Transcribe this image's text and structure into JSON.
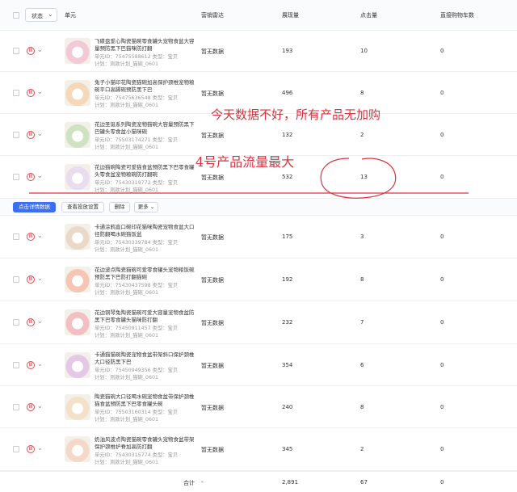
{
  "header": {
    "status_label": "状态",
    "unit": "单元",
    "radar": "营销雷达",
    "impressions": "展现量",
    "clicks": "点击量",
    "cart": "直接购物车数"
  },
  "rows_top": [
    {
      "name": "飞碟盘爱心陶瓷猫碗零食罐头宠物食盆大容量预防黑下巴猫咪防打翻",
      "unit_id": "单元ID：75475588612  类型：宝贝",
      "plan": "计划：测款计划_猫碗_0601",
      "radar": "暂无数据",
      "impressions": "193",
      "clicks": "10",
      "cart": "0",
      "thumb_color": "#f3c9d8"
    },
    {
      "name": "兔子小猫印花陶瓷猫碗加高保护颈椎宠物粮碗平口高脚碗预防黑下巴",
      "unit_id": "单元ID：75475636548  类型：宝贝",
      "plan": "计划：测款计划_猫碗_0601",
      "radar": "暂无数据",
      "impressions": "496",
      "clicks": "8",
      "cart": "0",
      "thumb_color": "#f4d8b8"
    },
    {
      "name": "花边圣诞系列陶瓷宠物猫碗大容量预防黑下巴罐头零食盆小猫咪碗",
      "unit_id": "单元ID：75503174271  类型：宝贝",
      "plan": "计划：测款计划_猫碗_0601",
      "radar": "暂无数据",
      "impressions": "132",
      "clicks": "2",
      "cart": "0",
      "thumb_color": "#cfe3c2"
    },
    {
      "name": "花边猫碗陶瓷可爱猫食盆预防黑下巴零食罐头零食盆宠物粮碗防打翻碗",
      "unit_id": "单元ID：75430319772  类型：宝贝",
      "plan": "计划：测款计划_猫碗_0601",
      "radar": "暂无数据",
      "impressions": "532",
      "clicks": "13",
      "cart": "0",
      "thumb_color": "#e8dcef"
    }
  ],
  "actions": {
    "detail": "点击详情数据",
    "view": "查看投放设置",
    "delete": "删除",
    "more": "更多"
  },
  "rows_bottom": [
    {
      "name": "卡通涂鸦直口碗印花猫咪陶瓷宠物食盆大口径防翻喝水碗猫饭盆",
      "unit_id": "单元ID：75430339784  类型：宝贝",
      "plan": "计划：测款计划_猫碗_0601",
      "radar": "暂无数据",
      "impressions": "175",
      "clicks": "3",
      "cart": "0",
      "thumb_color": "#ead9c6"
    },
    {
      "name": "花边波点陶瓷猫碗可爱零食罐头宠物粮饭碗预防黑下巴防打翻猫碗",
      "unit_id": "单元ID：75430437598  类型：宝贝",
      "plan": "计划：测款计划_猫碗_0601",
      "radar": "暂无数据",
      "impressions": "192",
      "clicks": "8",
      "cart": "0",
      "thumb_color": "#f6c6b5"
    },
    {
      "name": "花边铜琴兔陶瓷猫碗可爱大容量宠物食盆防黑下巴零食罐头猫咪防打翻",
      "unit_id": "单元ID：75450911457  类型：宝贝",
      "plan": "计划：测款计划_猫碗_0601",
      "radar": "暂无数据",
      "impressions": "232",
      "clicks": "7",
      "cart": "0",
      "thumb_color": "#f2c0c4"
    },
    {
      "name": "卡通猫猫碗陶瓷宠物食盆带架斜口保护颈椎大口径防黑下巴",
      "unit_id": "单元ID：75450949356  类型：宝贝",
      "plan": "计划：测款计划_猫碗_0601",
      "radar": "暂无数据",
      "impressions": "354",
      "clicks": "6",
      "cart": "0",
      "thumb_color": "#e5c7e6"
    },
    {
      "name": "陶瓷猫碗大口径喝水碗宠物食盆带保护颈椎猫食盆预防黑下巴零食罐头碗",
      "unit_id": "单元ID：75503160314  类型：宝贝",
      "plan": "计划：测款计划_猫碗_0601",
      "radar": "暂无数据",
      "impressions": "240",
      "clicks": "8",
      "cart": "0",
      "thumb_color": "#f3e2c9"
    },
    {
      "name": "奶油风波点陶瓷猫碗零食罐头宠物食盆带架保护颈椎护脊加高防打翻",
      "unit_id": "单元ID：75430315774  类型：宝贝",
      "plan": "计划：测款计划_猫碗_0601",
      "radar": "暂无数据",
      "impressions": "345",
      "clicks": "2",
      "cart": "0",
      "thumb_color": "#f4d9c9"
    }
  ],
  "total": {
    "label": "合计",
    "radar": "-",
    "impressions": "2,891",
    "clicks": "67",
    "cart": "0"
  },
  "annotations": {
    "note1": "今天数据不好，所有产品无加购",
    "note2": "4号产品流量最大",
    "color": "#d9343c"
  }
}
